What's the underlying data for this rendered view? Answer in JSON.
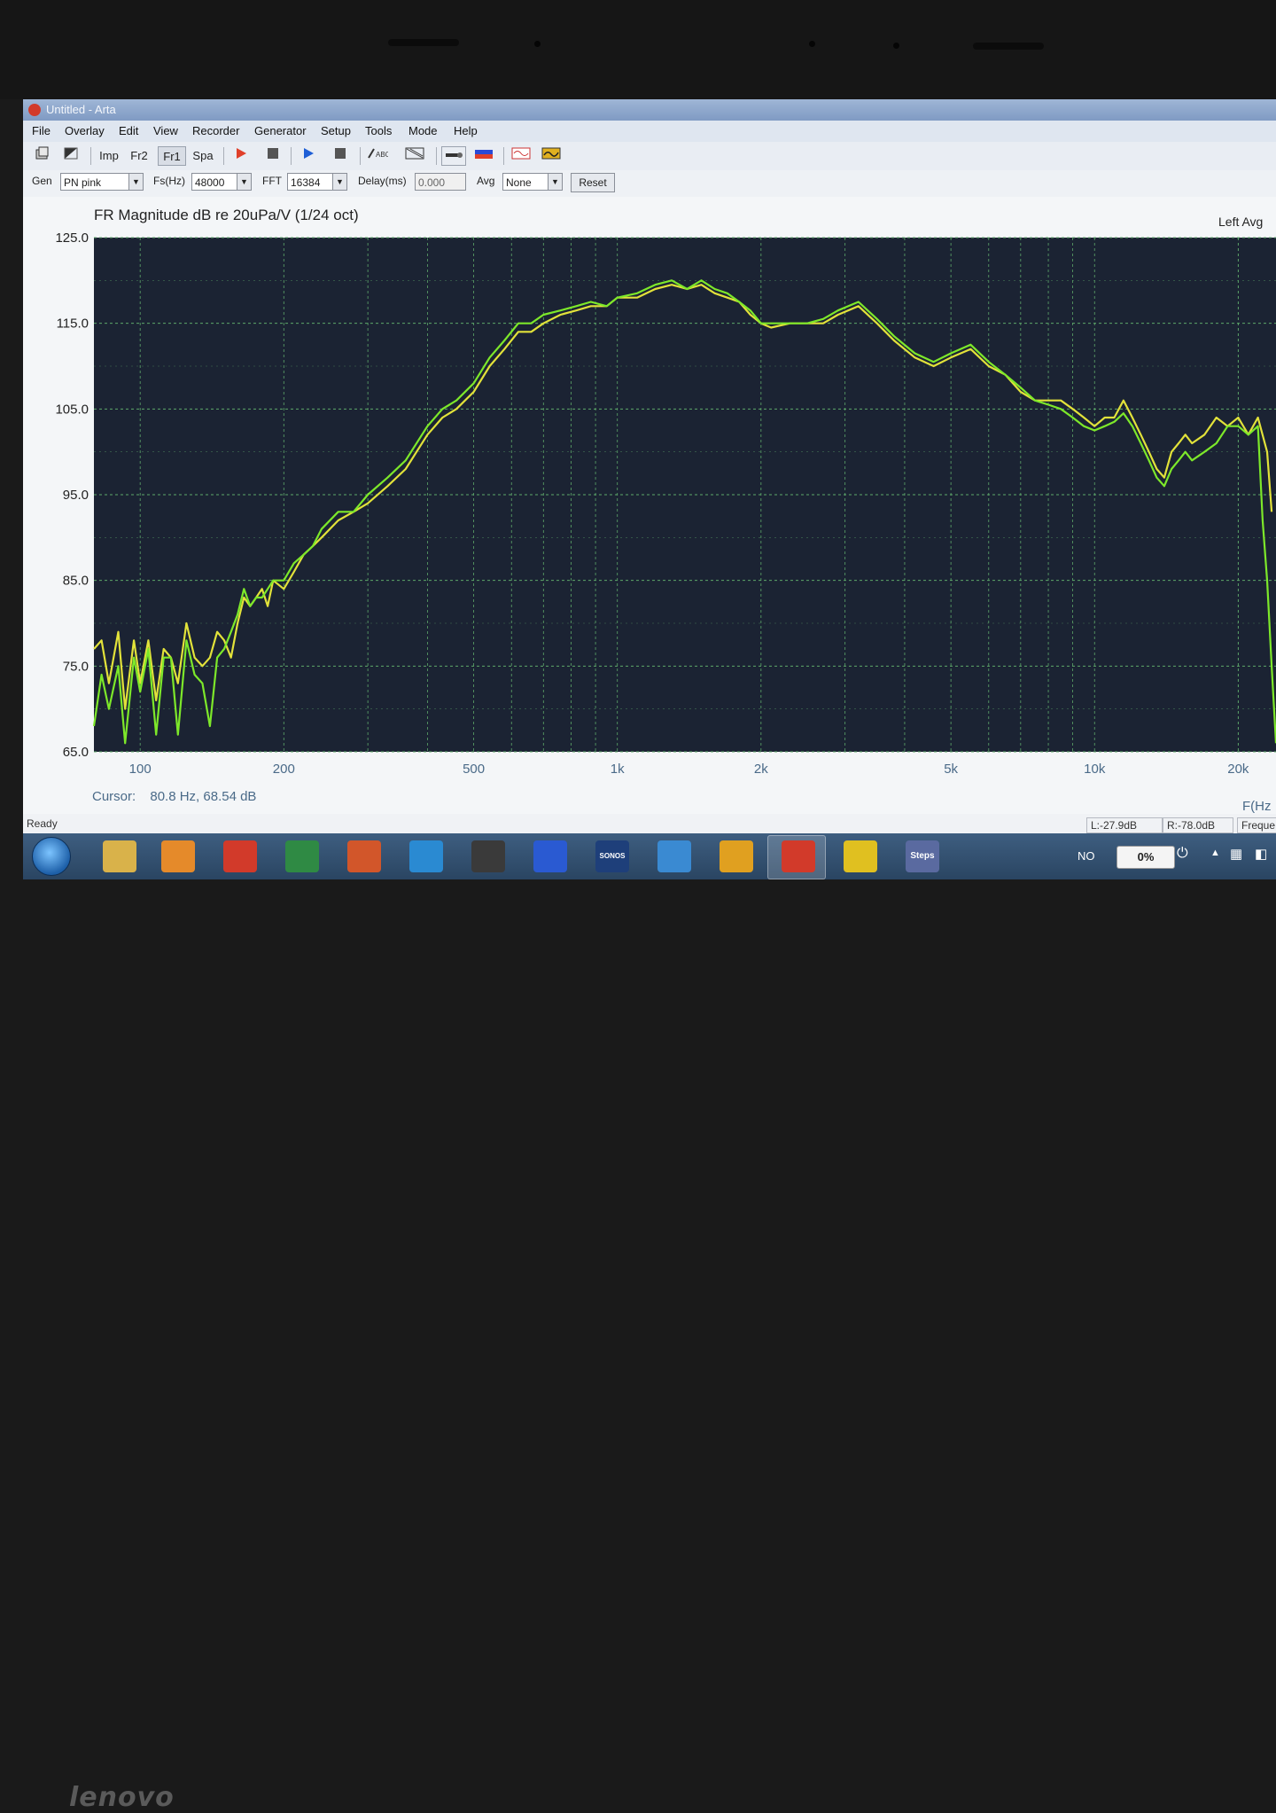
{
  "window": {
    "title": "Untitled - Arta"
  },
  "menu": [
    "File",
    "Overlay",
    "Edit",
    "View",
    "Recorder",
    "Generator",
    "Setup",
    "Tools",
    "Mode",
    "Help"
  ],
  "toolbar": {
    "buttons": [
      {
        "label": "",
        "icon": "open-file-icon"
      },
      {
        "label": "",
        "icon": "save-file-icon"
      },
      {
        "label": "Imp",
        "icon": "impulse-mode-icon"
      },
      {
        "label": "Fr2",
        "icon": "fr2-mode-icon"
      },
      {
        "label": "Fr1",
        "icon": "fr1-mode-icon"
      },
      {
        "label": "Spa",
        "icon": "spa-mode-icon"
      },
      {
        "label": "",
        "icon": "record-icon"
      },
      {
        "label": "",
        "icon": "stop-icon"
      },
      {
        "label": "",
        "icon": "play-icon"
      },
      {
        "label": "",
        "icon": "stop-icon"
      },
      {
        "label": "",
        "icon": "text-icon"
      },
      {
        "label": "",
        "icon": "chart-icon"
      },
      {
        "label": "",
        "icon": "probe-icon"
      },
      {
        "label": "",
        "icon": "color-bar-icon"
      },
      {
        "label": "",
        "icon": "wave-icon"
      },
      {
        "label": "",
        "icon": "oscilloscope-icon"
      }
    ]
  },
  "options": {
    "gen_label": "Gen",
    "gen_value": "PN pink",
    "fs_label": "Fs(Hz)",
    "fs_value": "48000",
    "fft_label": "FFT",
    "fft_value": "16384",
    "delay_label": "Delay(ms)",
    "delay_value": "0.000",
    "avg_label": "Avg",
    "avg_value": "None",
    "reset_label": "Reset"
  },
  "colors": {
    "plot_bg": "#1b2333",
    "grid": "#5ea86a",
    "trace_green": "#7de82a",
    "trace_yellow": "#e2e23a"
  },
  "chart_data": {
    "type": "line",
    "title": "FR Magnitude dB re 20uPa/V (1/24 oct)",
    "legend_right": "Left  Avg",
    "xlabel": "F(Hz",
    "xscale": "log",
    "xlim": [
      80,
      24000
    ],
    "ylim": [
      65,
      125
    ],
    "y_ticks": [
      "125.0",
      "115.0",
      "105.0",
      "95.0",
      "85.0",
      "75.0",
      "65.0"
    ],
    "x_ticks": [
      "100",
      "200",
      "500",
      "1k",
      "2k",
      "5k",
      "10k",
      "20k"
    ],
    "series": [
      {
        "color": "trace_yellow",
        "points": [
          [
            80,
            77
          ],
          [
            83,
            78
          ],
          [
            86,
            73
          ],
          [
            90,
            79
          ],
          [
            93,
            70
          ],
          [
            97,
            78
          ],
          [
            100,
            73
          ],
          [
            104,
            78
          ],
          [
            108,
            71
          ],
          [
            112,
            77
          ],
          [
            116,
            76
          ],
          [
            120,
            73
          ],
          [
            125,
            80
          ],
          [
            130,
            76
          ],
          [
            135,
            75
          ],
          [
            140,
            76
          ],
          [
            145,
            79
          ],
          [
            150,
            78
          ],
          [
            155,
            76
          ],
          [
            160,
            80
          ],
          [
            165,
            83
          ],
          [
            170,
            82
          ],
          [
            175,
            83
          ],
          [
            180,
            84
          ],
          [
            185,
            82
          ],
          [
            190,
            85
          ],
          [
            200,
            84
          ],
          [
            210,
            86
          ],
          [
            220,
            88
          ],
          [
            230,
            89
          ],
          [
            240,
            90
          ],
          [
            260,
            92
          ],
          [
            280,
            93
          ],
          [
            300,
            94
          ],
          [
            330,
            96
          ],
          [
            360,
            98
          ],
          [
            400,
            102
          ],
          [
            430,
            104
          ],
          [
            460,
            105
          ],
          [
            500,
            107
          ],
          [
            540,
            110
          ],
          [
            580,
            112
          ],
          [
            620,
            114
          ],
          [
            660,
            114
          ],
          [
            700,
            115
          ],
          [
            760,
            116
          ],
          [
            820,
            116.5
          ],
          [
            880,
            117
          ],
          [
            950,
            117
          ],
          [
            1000,
            118
          ],
          [
            1100,
            118
          ],
          [
            1200,
            119
          ],
          [
            1300,
            119.5
          ],
          [
            1400,
            119
          ],
          [
            1500,
            119.5
          ],
          [
            1600,
            118.5
          ],
          [
            1700,
            118
          ],
          [
            1800,
            117.5
          ],
          [
            1900,
            116
          ],
          [
            2000,
            115
          ],
          [
            2100,
            114.5
          ],
          [
            2300,
            115
          ],
          [
            2500,
            115
          ],
          [
            2700,
            115
          ],
          [
            2900,
            116
          ],
          [
            3200,
            117
          ],
          [
            3500,
            115
          ],
          [
            3800,
            113
          ],
          [
            4200,
            111
          ],
          [
            4600,
            110
          ],
          [
            5000,
            111
          ],
          [
            5500,
            112
          ],
          [
            6000,
            110
          ],
          [
            6500,
            109
          ],
          [
            7000,
            107
          ],
          [
            7500,
            106
          ],
          [
            8000,
            106
          ],
          [
            8500,
            106
          ],
          [
            9000,
            105
          ],
          [
            9500,
            104
          ],
          [
            10000,
            103
          ],
          [
            10500,
            104
          ],
          [
            11000,
            104
          ],
          [
            11500,
            106
          ],
          [
            12000,
            104
          ],
          [
            12500,
            102
          ],
          [
            13000,
            100
          ],
          [
            13500,
            98
          ],
          [
            14000,
            97
          ],
          [
            14500,
            100
          ],
          [
            15000,
            101
          ],
          [
            15500,
            102
          ],
          [
            16000,
            101
          ],
          [
            17000,
            102
          ],
          [
            18000,
            104
          ],
          [
            19000,
            103
          ],
          [
            20000,
            104
          ],
          [
            21000,
            102
          ],
          [
            22000,
            104
          ],
          [
            23000,
            100
          ],
          [
            23500,
            93
          ]
        ]
      },
      {
        "color": "trace_green",
        "points": [
          [
            80,
            68
          ],
          [
            83,
            74
          ],
          [
            86,
            70
          ],
          [
            90,
            75
          ],
          [
            93,
            66
          ],
          [
            97,
            76
          ],
          [
            100,
            72
          ],
          [
            104,
            77
          ],
          [
            108,
            67
          ],
          [
            112,
            76
          ],
          [
            116,
            76
          ],
          [
            120,
            67
          ],
          [
            125,
            78
          ],
          [
            130,
            74
          ],
          [
            135,
            73
          ],
          [
            140,
            68
          ],
          [
            145,
            76
          ],
          [
            150,
            77
          ],
          [
            155,
            79
          ],
          [
            160,
            81
          ],
          [
            165,
            84
          ],
          [
            170,
            82
          ],
          [
            175,
            83
          ],
          [
            180,
            83
          ],
          [
            185,
            84
          ],
          [
            190,
            85
          ],
          [
            200,
            85
          ],
          [
            210,
            87
          ],
          [
            220,
            88
          ],
          [
            230,
            89
          ],
          [
            240,
            91
          ],
          [
            260,
            93
          ],
          [
            280,
            93
          ],
          [
            300,
            95
          ],
          [
            330,
            97
          ],
          [
            360,
            99
          ],
          [
            400,
            103
          ],
          [
            430,
            105
          ],
          [
            460,
            106
          ],
          [
            500,
            108
          ],
          [
            540,
            111
          ],
          [
            580,
            113
          ],
          [
            620,
            115
          ],
          [
            660,
            115
          ],
          [
            700,
            116
          ],
          [
            760,
            116.5
          ],
          [
            820,
            117
          ],
          [
            880,
            117.5
          ],
          [
            950,
            117
          ],
          [
            1000,
            118
          ],
          [
            1100,
            118.5
          ],
          [
            1200,
            119.5
          ],
          [
            1300,
            120
          ],
          [
            1400,
            119
          ],
          [
            1500,
            120
          ],
          [
            1600,
            119
          ],
          [
            1700,
            118.5
          ],
          [
            1800,
            117.5
          ],
          [
            1900,
            116.5
          ],
          [
            2000,
            115
          ],
          [
            2100,
            115
          ],
          [
            2300,
            115
          ],
          [
            2500,
            115
          ],
          [
            2700,
            115.5
          ],
          [
            2900,
            116.5
          ],
          [
            3200,
            117.5
          ],
          [
            3500,
            115.5
          ],
          [
            3800,
            113.5
          ],
          [
            4200,
            111.5
          ],
          [
            4600,
            110.5
          ],
          [
            5000,
            111.5
          ],
          [
            5500,
            112.5
          ],
          [
            6000,
            110.5
          ],
          [
            6500,
            109
          ],
          [
            7000,
            107.5
          ],
          [
            7500,
            106
          ],
          [
            8000,
            105.5
          ],
          [
            8500,
            105
          ],
          [
            9000,
            104
          ],
          [
            9500,
            103
          ],
          [
            10000,
            102.5
          ],
          [
            10500,
            103
          ],
          [
            11000,
            103.5
          ],
          [
            11500,
            104.5
          ],
          [
            12000,
            103
          ],
          [
            12500,
            101
          ],
          [
            13000,
            99
          ],
          [
            13500,
            97
          ],
          [
            14000,
            96
          ],
          [
            14500,
            98
          ],
          [
            15000,
            99
          ],
          [
            15500,
            100
          ],
          [
            16000,
            99
          ],
          [
            17000,
            100
          ],
          [
            18000,
            101
          ],
          [
            19000,
            103
          ],
          [
            20000,
            103
          ],
          [
            21000,
            102
          ],
          [
            22000,
            103
          ],
          [
            22500,
            92
          ],
          [
            23000,
            85
          ],
          [
            23500,
            75
          ],
          [
            24000,
            66
          ]
        ]
      }
    ]
  },
  "cursor": {
    "label": "Cursor:",
    "value": "80.8 Hz, 68.54 dB"
  },
  "status": {
    "text": "Ready",
    "left_level": "L:-27.9dB",
    "right_level": "R:-78.0dB",
    "freq": "Freque"
  },
  "taskbar": {
    "apps": [
      {
        "icon": "file-explorer-icon",
        "color": "#d9b24a"
      },
      {
        "icon": "media-player-icon",
        "color": "#e58a2a"
      },
      {
        "icon": "red-grid-app-icon",
        "color": "#d23a2a"
      },
      {
        "icon": "excel-icon",
        "color": "#2f8a44"
      },
      {
        "icon": "powerpoint-icon",
        "color": "#d2562a"
      },
      {
        "icon": "media-center-icon",
        "color": "#2a8ad2"
      },
      {
        "icon": "xa-app-icon",
        "color": "#3a3a3a"
      },
      {
        "icon": "word-icon",
        "color": "#2a5ad2"
      },
      {
        "icon": "sonos-icon",
        "color": "#1e3f7a"
      },
      {
        "icon": "mail-app-icon",
        "color": "#3a8ad2"
      },
      {
        "icon": "outlook-icon",
        "color": "#e0a020"
      },
      {
        "icon": "arta-app-icon",
        "color": "#d23a2a"
      },
      {
        "icon": "lightning-app-icon",
        "color": "#e0c020"
      },
      {
        "icon": "steps-app-icon",
        "color": "#5a6aa0"
      }
    ],
    "sonos_label": "SONOS",
    "steps_label": "Steps",
    "lang": "NO",
    "battery": "0%"
  }
}
